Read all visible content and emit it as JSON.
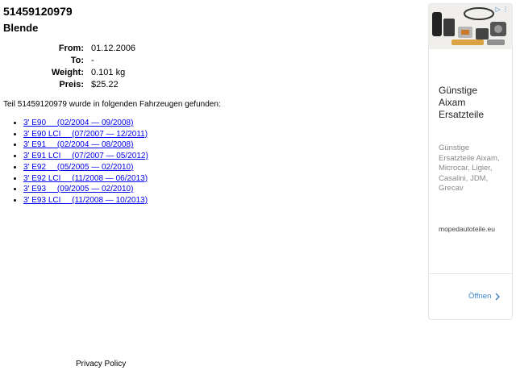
{
  "part": {
    "number": "51459120979",
    "name": "Blende"
  },
  "specs": [
    {
      "key": "From:",
      "value": "01.12.2006"
    },
    {
      "key": "To:",
      "value": "-"
    },
    {
      "key": "Weight:",
      "value": "0.101 kg"
    },
    {
      "key": "Preis:",
      "value": "$25.22"
    }
  ],
  "intro": "Teil 51459120979 wurde in folgenden Fahrzeugen gefunden:",
  "vehicles": [
    "3' E90     (02/2004 — 09/2008)",
    "3' E90 LCI     (07/2007 — 12/2011)",
    "3' E91     (02/2004 — 08/2008)",
    "3' E91 LCI     (07/2007 — 05/2012)",
    "3' E92     (05/2005 — 02/2010)",
    "3' E92 LCI     (11/2008 — 06/2013)",
    "3' E93     (09/2005 — 02/2010)",
    "3' E93 LCI     (11/2008 — 10/2013)"
  ],
  "footer": {
    "privacy": "Privacy Policy"
  },
  "ad": {
    "title": "Günstige Aixam Ersatzteile",
    "description": "Günstige Ersatzteile Aixam, Microcar, Ligier, Casalini, JDM, Grecav",
    "url": "mopedautoteile.eu",
    "cta": "Öffnen",
    "accent": "#3b82c4"
  }
}
